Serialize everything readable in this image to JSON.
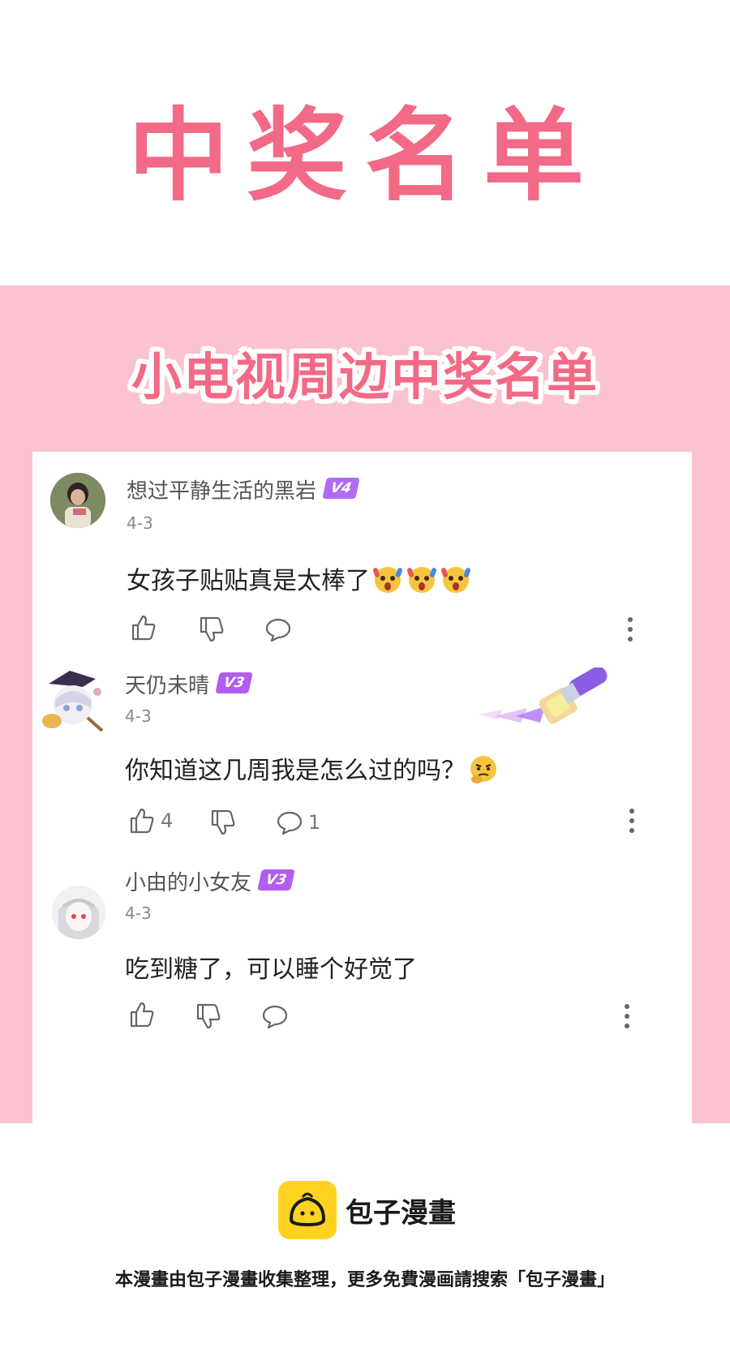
{
  "colors": {
    "title_pink": "#f26a86",
    "band_pink": "#fbc3cf",
    "badge_v4": "#b06bf5",
    "badge_v3": "#b35cf0",
    "brand_yellow": "#ffd21f"
  },
  "header": {
    "title": "中奖名单",
    "subtitle": "小电视周边中奖名单"
  },
  "comments": [
    {
      "username": "想过平静生活的黑岩",
      "level": "V4",
      "date": "4-3",
      "text": "女孩子贴贴真是太棒了",
      "emoji": "surprised-emoji",
      "likes": "",
      "replies": ""
    },
    {
      "username": "天仍未晴",
      "level": "V3",
      "date": "4-3",
      "text": "你知道这几周我是怎么过的吗？",
      "emoji": "thinking-emoji",
      "likes": "4",
      "replies": "1"
    },
    {
      "username": "小由的小女友",
      "level": "V3",
      "date": "4-3",
      "text": "吃到糖了，可以睡个好觉了",
      "emoji": "",
      "likes": "",
      "replies": ""
    }
  ],
  "footer": {
    "brand": "包子漫畫",
    "note": "本漫畫由包子漫畫收集整理，更多免費漫画請搜索「包子漫畫」"
  }
}
